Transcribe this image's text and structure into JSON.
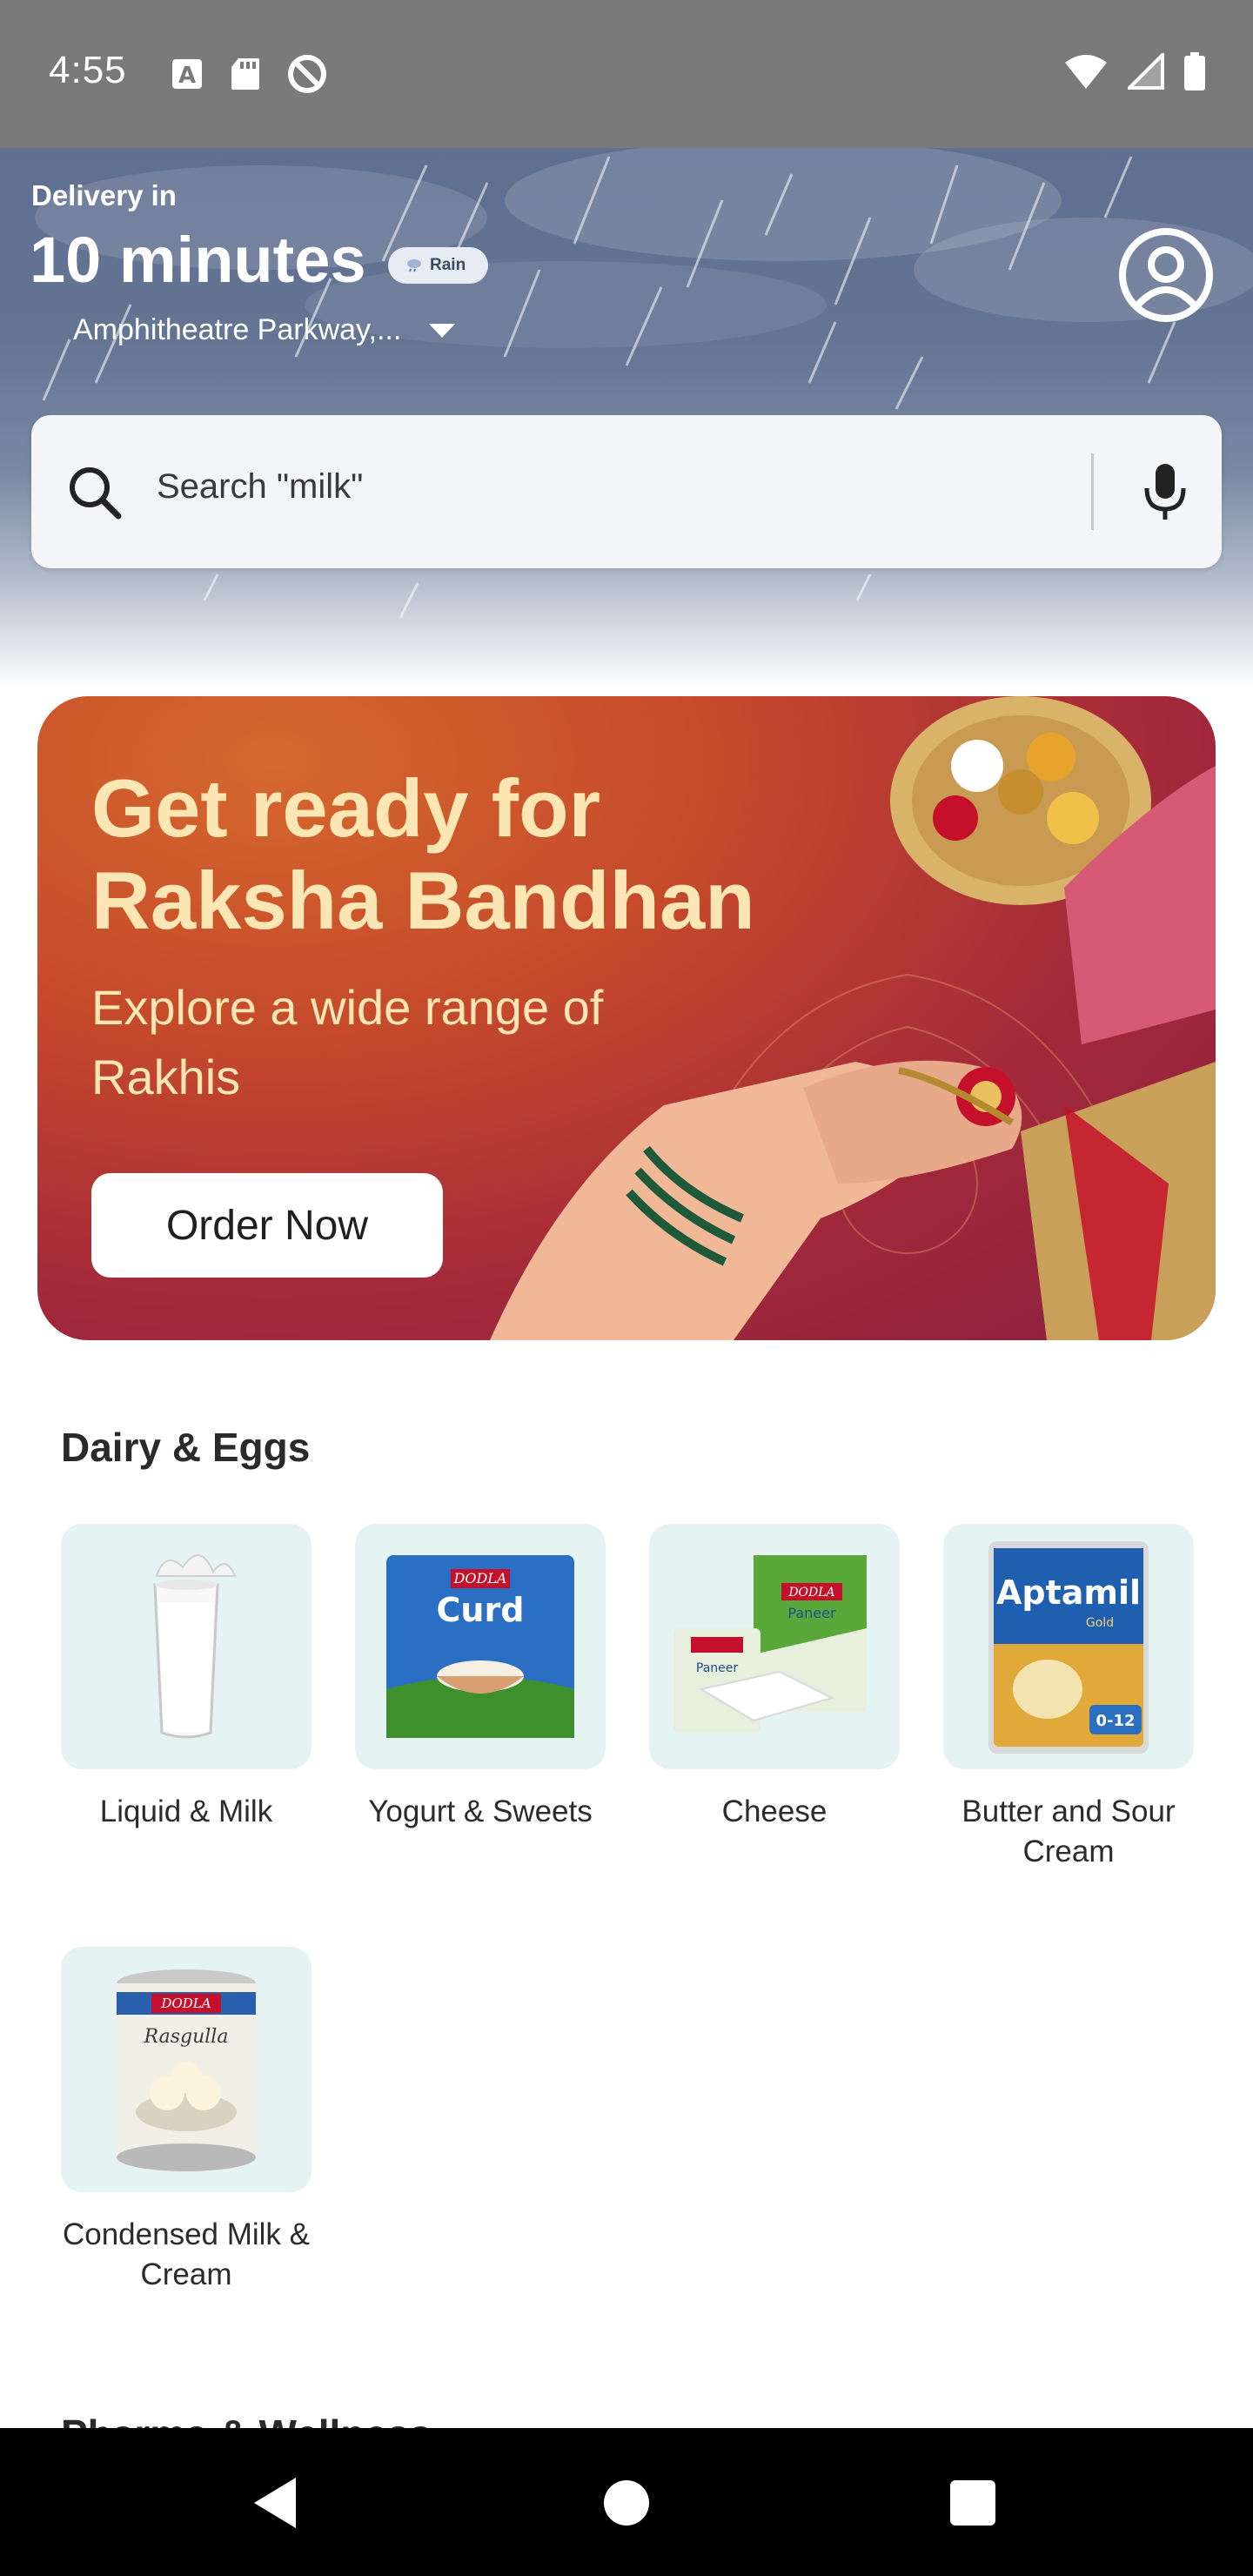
{
  "status_bar": {
    "time": "4:55",
    "left_icons": [
      "keyboard-a-icon",
      "sd-card-icon",
      "no-disturb-icon"
    ],
    "right_icons": [
      "wifi-icon",
      "signal-icon",
      "battery-icon"
    ]
  },
  "header": {
    "delivery_label": "Delivery in",
    "delivery_time": "10 minutes",
    "weather_badge": "Rain",
    "address": "Amphitheatre Parkway,..."
  },
  "search": {
    "placeholder": "Search \"milk\""
  },
  "banner": {
    "title": "Get ready for Raksha Bandhan",
    "subtitle": "Explore a wide range of Rakhis",
    "cta_label": "Order Now"
  },
  "dairy_section": {
    "title": "Dairy & Eggs",
    "categories": [
      {
        "label": "Liquid & Milk",
        "icon": "milk-glass-icon"
      },
      {
        "label": "Yogurt & Sweets",
        "icon": "curd-pack-icon"
      },
      {
        "label": "Cheese",
        "icon": "paneer-pack-icon"
      },
      {
        "label": "Butter and Sour Cream",
        "icon": "aptamil-can-icon"
      },
      {
        "label": "Condensed Milk & Cream",
        "icon": "rasgulla-tin-icon"
      }
    ]
  },
  "next_section": {
    "title": "Pharma & Wellness"
  },
  "colors": {
    "header_bg": "#647493",
    "tile_bg": "#e6f3f3",
    "banner_text": "#fbe6b4",
    "banner_bg": "#a52a3a"
  }
}
